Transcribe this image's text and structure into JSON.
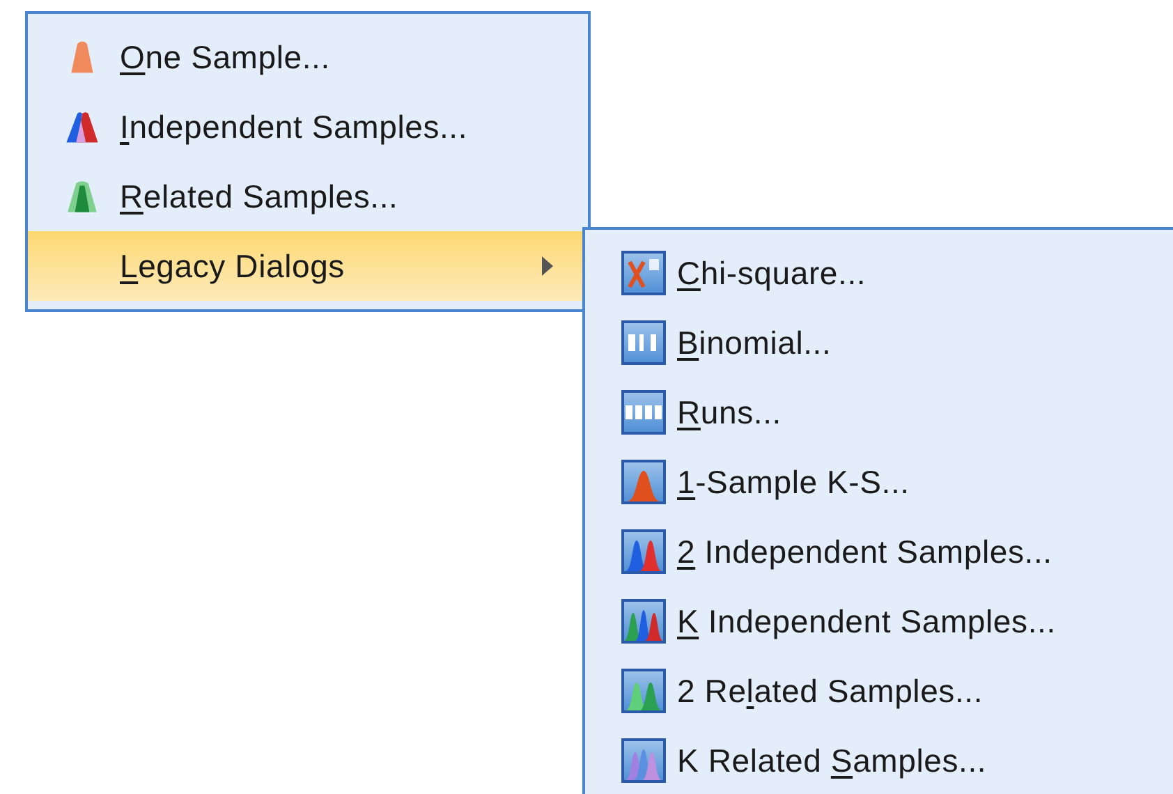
{
  "menu": {
    "items": [
      {
        "key": "O",
        "rest": "ne Sample...",
        "selected": false,
        "submenu": false
      },
      {
        "key": "I",
        "rest": "ndependent Samples...",
        "selected": false,
        "submenu": false
      },
      {
        "key": "R",
        "rest": "elated Samples...",
        "selected": false,
        "submenu": false
      },
      {
        "key": "L",
        "rest": "egacy Dialogs",
        "selected": true,
        "submenu": true
      }
    ]
  },
  "submenu": {
    "items": [
      {
        "key": "C",
        "rest": "hi-square..."
      },
      {
        "key": "B",
        "rest": "inomial..."
      },
      {
        "key": "R",
        "rest": "uns..."
      },
      {
        "key": "1",
        "rest": "-Sample K-S..."
      },
      {
        "key": "2",
        "rest": " Independent Samples..."
      },
      {
        "key": "K",
        "rest": " Independent Samples..."
      },
      {
        "pre": "2 Re",
        "key": "l",
        "rest": "ated Samples..."
      },
      {
        "pre": "K Related ",
        "key": "S",
        "rest": "amples..."
      }
    ]
  }
}
